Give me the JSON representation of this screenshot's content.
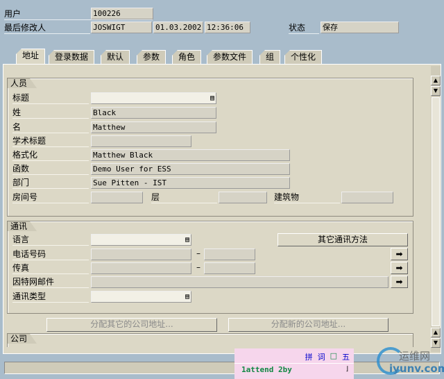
{
  "header": {
    "user_label": "用户",
    "user_value": "100226",
    "changed_by_label": "最后修改人",
    "changed_by_value": "JOSWIGT",
    "date": "01.03.2002",
    "time": "12:36:06",
    "status_label": "状态",
    "status_value": "保存"
  },
  "tabs": [
    {
      "label": "地址",
      "active": true
    },
    {
      "label": "登录数据"
    },
    {
      "label": "默认"
    },
    {
      "label": "参数"
    },
    {
      "label": "角色"
    },
    {
      "label": "参数文件"
    },
    {
      "label": "组"
    },
    {
      "label": "个性化"
    }
  ],
  "person": {
    "title": "人员",
    "fields": {
      "salutation": {
        "label": "标题",
        "value": ""
      },
      "last_name": {
        "label": "姓",
        "value": "Black"
      },
      "first_name": {
        "label": "名",
        "value": "Matthew"
      },
      "academic_title": {
        "label": "学术标题",
        "value": ""
      },
      "format": {
        "label": "格式化",
        "value": "Matthew Black"
      },
      "function": {
        "label": "函数",
        "value": "Demo User for ESS"
      },
      "department": {
        "label": "部门",
        "value": "Sue Pitten - IST"
      },
      "room": {
        "label": "房间号",
        "value": ""
      },
      "floor": {
        "label": "层",
        "value": ""
      },
      "building": {
        "label": "建筑物",
        "value": ""
      }
    }
  },
  "comm": {
    "title": "通讯",
    "language": {
      "label": "语言",
      "value": ""
    },
    "other_methods_button": "其它通讯方法",
    "phone": {
      "label": "电话号码",
      "value": "",
      "ext": "",
      "sep": "–"
    },
    "fax": {
      "label": "传真",
      "value": "",
      "ext": "",
      "sep": "–"
    },
    "email": {
      "label": "因特网邮件",
      "value": ""
    },
    "comm_type": {
      "label": "通讯类型",
      "value": ""
    }
  },
  "buttons": {
    "assign_other": "分配其它的公司地址...",
    "assign_new": "分配新的公司地址..."
  },
  "company": {
    "title": "公司"
  },
  "ime": {
    "icons": [
      "拼",
      "词",
      "□",
      "五"
    ],
    "input": "1attend 2by",
    "colors": {
      "bg": "#f6d6ec",
      "text": "#118844",
      "icon": "#0000cc"
    }
  },
  "watermark": {
    "line1": "运维网",
    "line2": "iyunv.com"
  },
  "colors": {
    "background": "#a9bccb",
    "panel": "#dcd8c6",
    "field": "#d6d3c6"
  }
}
